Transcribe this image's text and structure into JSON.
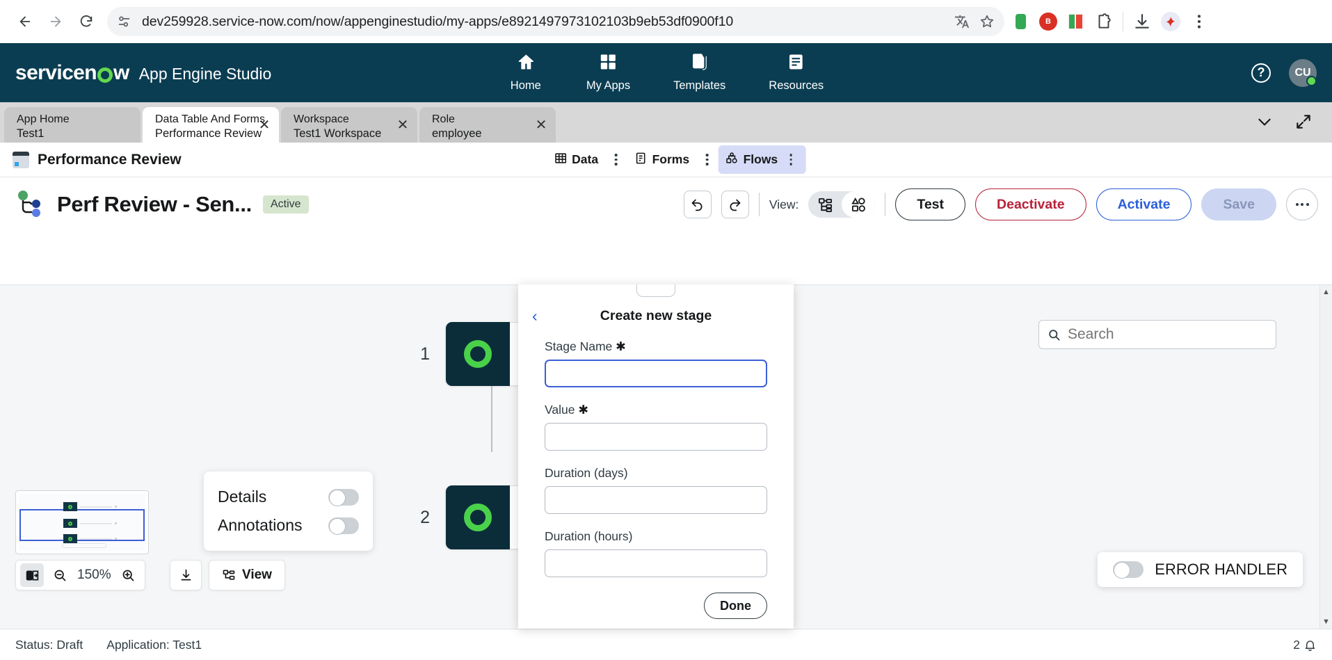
{
  "browser": {
    "url": "dev259928.service-now.com/now/appenginestudio/my-apps/e8921497973102103b9eb53df0900f10",
    "back_label": "Back",
    "forward_label": "Forward",
    "reload_label": "Reload",
    "translate_label": "Translate",
    "bookmark_label": "Bookmark this tab",
    "downloads_label": "Downloads",
    "menu_label": "Customize and control",
    "extension_badge": "B"
  },
  "header": {
    "brand_prefix": "servicen",
    "brand_suffix": "w",
    "app_title": "App Engine Studio",
    "nav": [
      {
        "label": "Home",
        "icon": "home-icon",
        "active": false
      },
      {
        "label": "My Apps",
        "icon": "grid-icon",
        "active": true
      },
      {
        "label": "Templates",
        "icon": "templates-icon",
        "active": false
      },
      {
        "label": "Resources",
        "icon": "resources-icon",
        "active": false
      }
    ],
    "help_label": "?",
    "avatar_initials": "CU"
  },
  "tabs": [
    {
      "title": "App Home",
      "sub": "Test1",
      "active": false,
      "closable": false
    },
    {
      "title": "Data Table And Forms",
      "sub": "Performance Review",
      "active": true,
      "closable": true
    },
    {
      "title": "Workspace",
      "sub": "Test1 Workspace",
      "active": false,
      "closable": true
    },
    {
      "title": "Role",
      "sub": "employee",
      "active": false,
      "closable": true
    }
  ],
  "tabstrip": {
    "collapse_label": "Collapse tabs",
    "expand_label": "Expand"
  },
  "subtoolbar": {
    "title": "Performance Review",
    "segments": [
      {
        "label": "Data",
        "icon": "table-icon",
        "active": false
      },
      {
        "label": "Forms",
        "icon": "forms-icon",
        "active": false
      },
      {
        "label": "Flows",
        "icon": "flows-icon",
        "active": true
      }
    ]
  },
  "actionbar": {
    "flow_title": "Perf Review - Sen...",
    "status_badge": "Active",
    "undo_label": "Undo",
    "redo_label": "Redo",
    "view_label": "View:",
    "view_modes": [
      {
        "name": "tree-view",
        "active": true
      },
      {
        "name": "diagram-view",
        "active": false
      }
    ],
    "buttons": [
      {
        "label": "Test",
        "style": "default"
      },
      {
        "label": "Deactivate",
        "style": "danger"
      },
      {
        "label": "Activate",
        "style": "primary-outline"
      },
      {
        "label": "Save",
        "style": "disabled"
      }
    ],
    "more_label": "More actions"
  },
  "canvas": {
    "search_placeholder": "Search",
    "search_value": "",
    "nodes": [
      {
        "number": "1",
        "logo": "servicenow-logo"
      },
      {
        "number": "2",
        "logo": "servicenow-logo"
      }
    ]
  },
  "modal": {
    "back_label": "Back",
    "title": "Create new stage",
    "fields": [
      {
        "label": "Stage Name",
        "required": true,
        "value": "",
        "focused": true
      },
      {
        "label": "Value",
        "required": true,
        "value": "",
        "focused": false
      },
      {
        "label": "Duration (days)",
        "required": false,
        "value": "",
        "focused": false
      },
      {
        "label": "Duration (hours)",
        "required": false,
        "value": "",
        "focused": false
      }
    ],
    "done_label": "Done"
  },
  "bottom_controls": {
    "minimap_label": "Minimap",
    "fit_label": "Fit to screen",
    "zoom_out_label": "Zoom out",
    "zoom_level": "150%",
    "zoom_in_label": "Zoom in",
    "download_label": "Download",
    "view_button_label": "View",
    "details_label": "Details",
    "details_on": false,
    "annotations_label": "Annotations",
    "annotations_on": false,
    "error_handler_label": "ERROR HANDLER",
    "error_handler_on": false
  },
  "statusbar": {
    "status": "Status: Draft",
    "application": "Application: Test1",
    "notification_count": "2"
  },
  "colors": {
    "sn_navy": "#0b3d52",
    "sn_green": "#62d84e",
    "accent_blue": "#2a5fd9",
    "danger_red": "#b8213a",
    "badge_green_bg": "#d6e5cd",
    "canvas_bg": "#f5f6f7"
  }
}
